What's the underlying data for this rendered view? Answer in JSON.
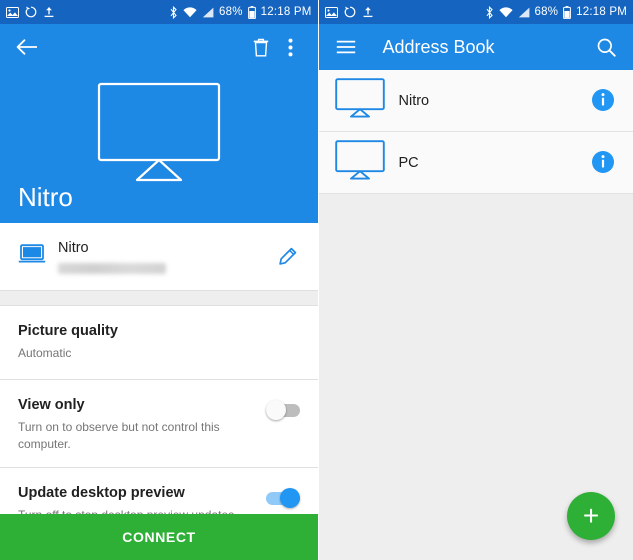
{
  "status_bar": {
    "icons_left": [
      "image-icon",
      "refresh-icon",
      "upload-icon"
    ],
    "icons_right": [
      "bluetooth-icon",
      "wifi-icon",
      "signal-icon"
    ],
    "battery": "68%",
    "time": "12:18 PM"
  },
  "left_screen": {
    "appbar": {
      "back_icon": "back-arrow-icon",
      "delete_icon": "trash-icon",
      "overflow_icon": "more-vertical-icon"
    },
    "hero": {
      "monitor_icon": "monitor-icon",
      "title": "Nitro"
    },
    "device": {
      "icon": "laptop-icon",
      "name": "Nitro",
      "subtitle_blurred": true,
      "edit_icon": "pencil-icon"
    },
    "settings": [
      {
        "title": "Picture quality",
        "subtitle": "Automatic",
        "control": "none"
      },
      {
        "title": "View only",
        "subtitle": "Turn on to observe but not control this computer.",
        "control": "toggle",
        "value": "off"
      },
      {
        "title": "Update desktop preview",
        "subtitle": "Turn off to stop desktop preview updates.",
        "control": "toggle",
        "value": "on"
      }
    ],
    "connect_label": "CONNECT",
    "connect_color": "#2eaf36"
  },
  "right_screen": {
    "appbar": {
      "menu_icon": "hamburger-menu-icon",
      "title": "Address Book",
      "search_icon": "search-icon"
    },
    "entries": [
      {
        "icon": "monitor-icon",
        "name": "Nitro",
        "info_icon": "info-icon"
      },
      {
        "icon": "monitor-icon",
        "name": "PC",
        "info_icon": "info-icon"
      }
    ],
    "fab": {
      "icon": "plus-icon",
      "label": "+",
      "color": "#2eaf36"
    }
  },
  "colors": {
    "primary": "#1e88e5",
    "status_bar": "#1565c0",
    "accent_green": "#2eaf36",
    "info_blue": "#2196f3"
  }
}
